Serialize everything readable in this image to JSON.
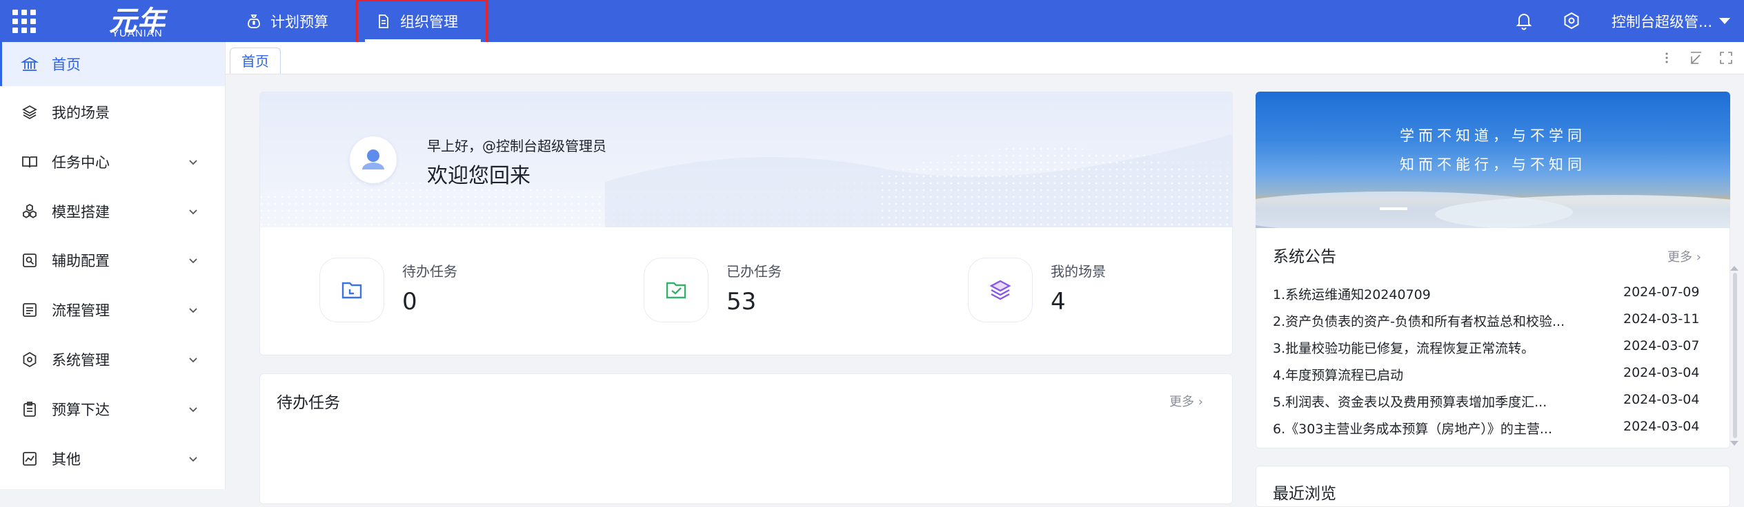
{
  "header": {
    "logo_cn": "元年",
    "logo_en": "YUANIAN",
    "nav": [
      {
        "label": "计划预算",
        "icon": "moneybag-icon"
      },
      {
        "label": "组织管理",
        "icon": "document-icon"
      }
    ],
    "user": "控制台超级管..."
  },
  "sidebar": {
    "items": [
      {
        "label": "首页",
        "icon": "bank-icon",
        "expandable": false,
        "active": true
      },
      {
        "label": "我的场景",
        "icon": "layers-icon",
        "expandable": false
      },
      {
        "label": "任务中心",
        "icon": "book-icon",
        "expandable": true
      },
      {
        "label": "模型搭建",
        "icon": "cubes-icon",
        "expandable": true
      },
      {
        "label": "辅助配置",
        "icon": "image-search-icon",
        "expandable": true
      },
      {
        "label": "流程管理",
        "icon": "flow-doc-icon",
        "expandable": true
      },
      {
        "label": "系统管理",
        "icon": "gear-icon",
        "expandable": true
      },
      {
        "label": "预算下达",
        "icon": "clipboard-icon",
        "expandable": true
      },
      {
        "label": "其他",
        "icon": "chart-icon",
        "expandable": true
      }
    ]
  },
  "tabs": [
    {
      "label": "首页"
    }
  ],
  "welcome": {
    "greeting": "早上好，@控制台超级管理员",
    "title": "欢迎您回来",
    "stats": [
      {
        "label": "待办任务",
        "value": "0",
        "icon": "folder-clock-icon",
        "color": "#3a72e8"
      },
      {
        "label": "已办任务",
        "value": "53",
        "icon": "folder-check-icon",
        "color": "#33b06a"
      },
      {
        "label": "我的场景",
        "value": "4",
        "icon": "layers-icon",
        "color": "#8a56e6"
      }
    ]
  },
  "todo": {
    "title": "待办任务",
    "more": "更多 ›"
  },
  "banner": {
    "line1": "学而不知道，与不学同",
    "line2": "知而不能行，与不知同"
  },
  "notice": {
    "title": "系统公告",
    "more": "更多 ›",
    "items": [
      {
        "title": "1.系统运维通知20240709",
        "date": "2024-07-09"
      },
      {
        "title": "2.资产负债表的资产-负债和所有者权益总和校验...",
        "date": "2024-03-11"
      },
      {
        "title": "3.批量校验功能已修复，流程恢复正常流转。",
        "date": "2024-03-07"
      },
      {
        "title": "4.年度预算流程已启动",
        "date": "2024-03-04"
      },
      {
        "title": "5.利润表、资金表以及费用预算表增加季度汇...",
        "date": "2024-03-04"
      },
      {
        "title": "6.《303主营业务成本预算（房地产）》的主营...",
        "date": "2024-03-04"
      }
    ]
  },
  "recent": {
    "title": "最近浏览"
  },
  "colors": {
    "primary": "#3a63e0",
    "accent": "#2f63e6",
    "highlight": "#e8242a"
  }
}
